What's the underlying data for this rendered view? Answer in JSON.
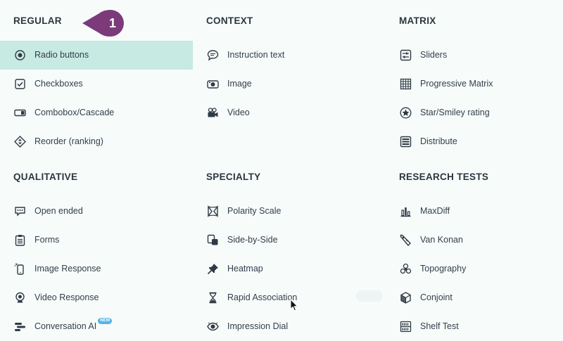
{
  "callout": {
    "number": "1",
    "color": "#7c3a7a"
  },
  "colors": {
    "selected_bg": "#c7eae2",
    "background": "#f7fbfa",
    "badge": "#55b4e6"
  },
  "columns": [
    [
      {
        "heading": "REGULAR",
        "items": [
          {
            "label": "Radio buttons",
            "icon": "radio-icon",
            "selected": true
          },
          {
            "label": "Checkboxes",
            "icon": "checkbox-icon"
          },
          {
            "label": "Combobox/Cascade",
            "icon": "combobox-icon"
          },
          {
            "label": "Reorder (ranking)",
            "icon": "reorder-icon"
          }
        ]
      },
      {
        "heading": "QUALITATIVE",
        "items": [
          {
            "label": "Open ended",
            "icon": "speech-bubble-icon"
          },
          {
            "label": "Forms",
            "icon": "clipboard-icon"
          },
          {
            "label": "Image Response",
            "icon": "phone-icon"
          },
          {
            "label": "Video Response",
            "icon": "webcam-icon"
          },
          {
            "label": "Conversation AI",
            "icon": "conversation-icon",
            "badge": "NEW"
          }
        ]
      }
    ],
    [
      {
        "heading": "CONTEXT",
        "items": [
          {
            "label": "Instruction text",
            "icon": "chat-icon"
          },
          {
            "label": "Image",
            "icon": "camera-icon"
          },
          {
            "label": "Video",
            "icon": "video-camera-icon"
          }
        ]
      },
      {
        "heading": "SPECIALTY",
        "items": [
          {
            "label": "Polarity Scale",
            "icon": "polarity-icon"
          },
          {
            "label": "Side-by-Side",
            "icon": "side-by-side-icon"
          },
          {
            "label": "Heatmap",
            "icon": "pin-icon"
          },
          {
            "label": "Rapid Association",
            "icon": "hourglass-icon"
          },
          {
            "label": "Impression Dial",
            "icon": "eye-icon"
          }
        ]
      }
    ],
    [
      {
        "heading": "MATRIX",
        "items": [
          {
            "label": "Sliders",
            "icon": "sliders-icon"
          },
          {
            "label": "Progressive Matrix",
            "icon": "grid-icon"
          },
          {
            "label": "Star/Smiley rating",
            "icon": "star-icon"
          },
          {
            "label": "Distribute",
            "icon": "distribute-icon"
          }
        ]
      },
      {
        "heading": "RESEARCH TESTS",
        "items": [
          {
            "label": "MaxDiff",
            "icon": "bar-chart-icon"
          },
          {
            "label": "Van Konan",
            "icon": "price-tag-icon"
          },
          {
            "label": "Topography",
            "icon": "topography-icon"
          },
          {
            "label": "Conjoint",
            "icon": "cube-icon"
          },
          {
            "label": "Shelf Test",
            "icon": "shelf-icon"
          }
        ]
      }
    ]
  ]
}
